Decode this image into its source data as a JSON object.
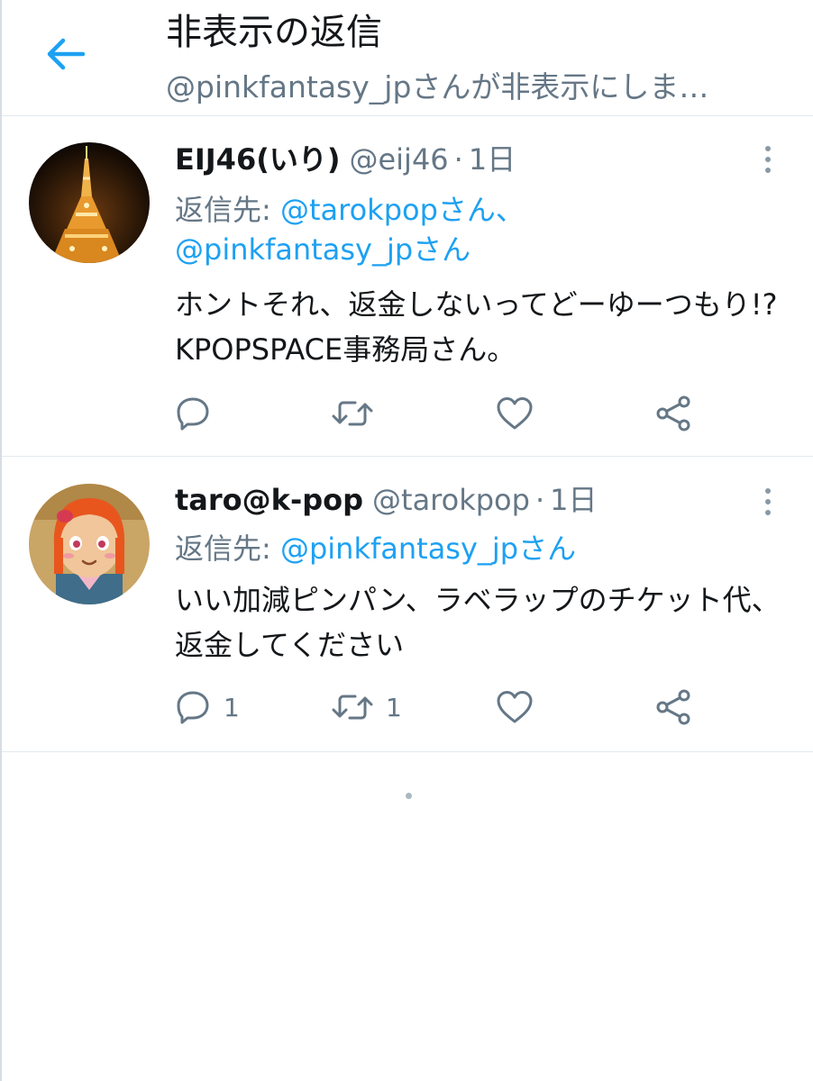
{
  "header": {
    "title": "非表示の返信",
    "subtitle": "@pinkfantasy_jpさんが非表示にしま…"
  },
  "colors": {
    "accent": "#1da1f2",
    "secondary_text": "#657786",
    "divider": "#e1e8ed"
  },
  "tweets": [
    {
      "display_name": "EIJ46(いり)",
      "handle": "@eij46",
      "separator": "·",
      "time": "1日",
      "reply_prefix": "返信先: ",
      "reply_mentions": [
        "@tarokpopさん、",
        "@pinkfantasy_jpさん"
      ],
      "text": "ホントそれ、返金しないってどーゆーつもり!?KPOPSPACE事務局さん。",
      "reply_count": "",
      "retweet_count": ""
    },
    {
      "display_name": "taro@k-pop",
      "handle": "@tarokpop",
      "separator": "·",
      "time": "1日",
      "reply_prefix": "返信先: ",
      "reply_mentions": [
        "@pinkfantasy_jpさん"
      ],
      "text": "いい加減ピンパン、ラベラップのチケット代、返金してください",
      "reply_count": "1",
      "retweet_count": "1"
    }
  ],
  "icons": {
    "back": "arrow-left-icon",
    "more": "more-vertical-icon",
    "reply": "reply-icon",
    "retweet": "retweet-icon",
    "like": "heart-icon",
    "share": "share-icon"
  }
}
